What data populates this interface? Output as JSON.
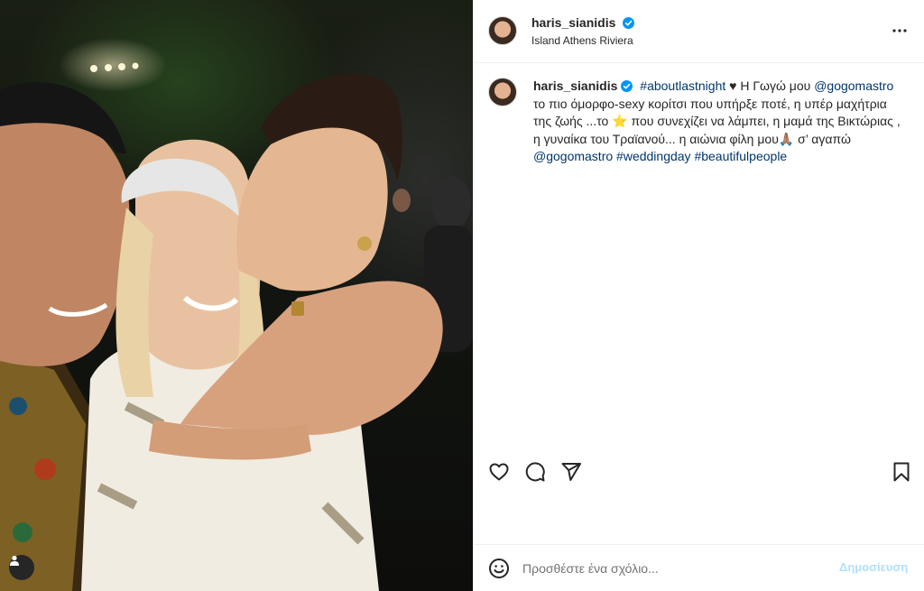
{
  "post": {
    "author": "haris_sianidis",
    "location": "Island Athens Riviera",
    "caption": {
      "hashtag_1": "#aboutlastnight",
      "text_1": " ♥ Η Γωγώ μου ",
      "mention_1": "@gogomastro",
      "text_2": " το πιο όμορφο-sexy κορίτσι που υπήρξε ποτέ, η υπέρ μαχήτρια της ζωής ...το ⭐ που συνεχίζει να λάμπει, η μαμά της Βικτώριας , η γυναίκα του Τραϊανού... η αιώνια φίλη μου🙏🏽 σ’ αγαπώ ",
      "mention_2": "@gogomastro",
      "hashtag_2": "#weddingday",
      "hashtag_3": "#beautifulpeople"
    }
  },
  "comment_box": {
    "placeholder": "Προσθέστε ένα σχόλιο...",
    "post_label": "Δημοσίευση"
  },
  "colors": {
    "verified_badge": "#0095f6",
    "link": "#00376b",
    "post_button_disabled": "#b2dffc"
  },
  "icons": {
    "header_more": "more-horizontal-icon",
    "like": "heart-icon",
    "comment": "comment-icon",
    "share": "share-icon",
    "save": "bookmark-icon",
    "emoji": "emoji-icon",
    "tag": "user-tag-icon"
  }
}
